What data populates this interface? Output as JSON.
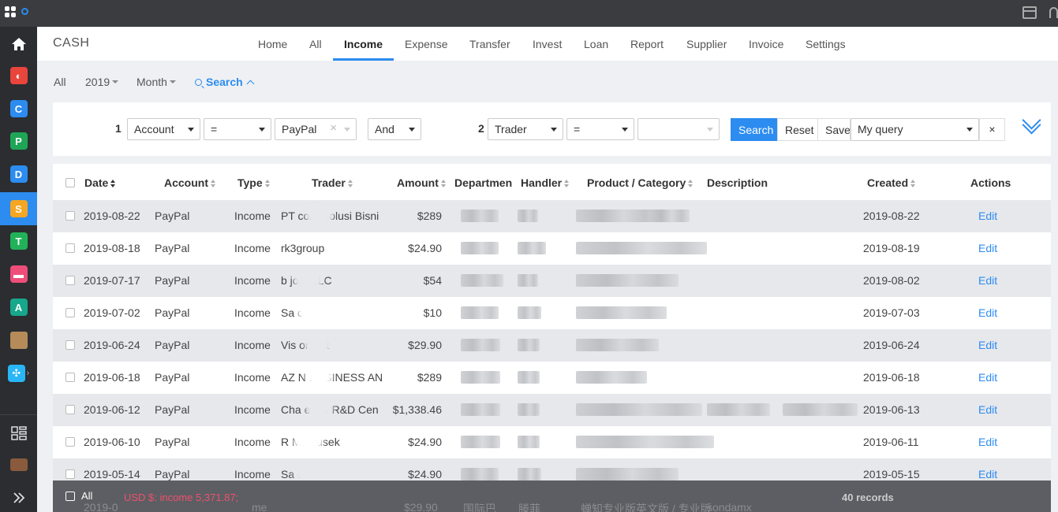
{
  "sidebar": {
    "apps": [
      {
        "name": "home",
        "color": "#ffffff",
        "letter": ""
      },
      {
        "name": "app-red",
        "color": "#e8453c",
        "letter": "◐"
      },
      {
        "name": "app-blue",
        "color": "#2c8cf0",
        "letter": "C"
      },
      {
        "name": "app-green",
        "color": "#1ea656",
        "letter": "P"
      },
      {
        "name": "app-blue2",
        "color": "#2c8cf0",
        "letter": "D"
      },
      {
        "name": "app-cash",
        "color": "#f5a623",
        "letter": "S"
      },
      {
        "name": "app-green2",
        "color": "#21b259",
        "letter": "T"
      },
      {
        "name": "app-pink",
        "color": "#ee4d7a",
        "letter": "▬"
      },
      {
        "name": "app-teal",
        "color": "#17a78b",
        "letter": "A"
      },
      {
        "name": "app-avatar",
        "color": "#b58b5a",
        "letter": ""
      },
      {
        "name": "app-more",
        "color": "#29b6f6",
        "letter": "✣"
      }
    ]
  },
  "header": {
    "brand": "CASH",
    "nav": [
      "Home",
      "All",
      "Income",
      "Expense",
      "Transfer",
      "Invest",
      "Loan",
      "Report",
      "Supplier",
      "Invoice",
      "Settings"
    ],
    "active": "Income"
  },
  "filters": {
    "all": "All",
    "year": "2019",
    "period": "Month",
    "search": "Search"
  },
  "query": {
    "c1_num": "1",
    "c1_field": "Account",
    "c1_op": "=",
    "c1_value": "PayPal",
    "logic": "And",
    "c2_num": "2",
    "c2_field": "Trader",
    "c2_op": "=",
    "c2_value": "",
    "search_btn": "Search",
    "reset_btn": "Reset",
    "save_btn": "Save",
    "saved_query": "My query",
    "clear": "×"
  },
  "table": {
    "headers": {
      "date": "Date",
      "account": "Account",
      "type": "Type",
      "trader": "Trader",
      "amount": "Amount",
      "department": "Departmen",
      "handler": "Handler",
      "product": "Product / Category",
      "description": "Description",
      "created": "Created",
      "actions": "Actions"
    },
    "rows": [
      {
        "date": "2019-08-22",
        "account": "PayPal",
        "type": "Income",
        "trader": "PT    com Solusi Bisni",
        "amount": "$289",
        "created": "2019-08-22",
        "action": "Edit"
      },
      {
        "date": "2019-08-18",
        "account": "PayPal",
        "type": "Income",
        "trader": "rk3group",
        "amount": "$24.90",
        "created": "2019-08-19",
        "action": "Edit"
      },
      {
        "date": "2019-07-17",
        "account": "PayPal",
        "type": "Income",
        "trader": "b       jour LLC",
        "amount": "$54",
        "created": "2019-08-02",
        "action": "Edit"
      },
      {
        "date": "2019-07-02",
        "account": "PayPal",
        "type": "Income",
        "trader": "Sa       o",
        "amount": "$10",
        "created": "2019-07-03",
        "action": "Edit"
      },
      {
        "date": "2019-06-24",
        "account": "PayPal",
        "type": "Income",
        "trader": "Vis        ontext",
        "amount": "$29.90",
        "created": "2019-06-24",
        "action": "Edit"
      },
      {
        "date": "2019-06-18",
        "account": "PayPal",
        "type": "Income",
        "trader": "AZ     N BUSINESS AN",
        "amount": "$289",
        "created": "2019-06-18",
        "action": "Edit"
      },
      {
        "date": "2019-06-12",
        "account": "PayPal",
        "type": "Income",
        "trader": "Cha       e US R&D Cen",
        "amount": "$1,338.46",
        "created": "2019-06-13",
        "action": "Edit"
      },
      {
        "date": "2019-06-10",
        "account": "PayPal",
        "type": "Income",
        "trader": "R       Matousek",
        "amount": "$24.90",
        "created": "2019-06-11",
        "action": "Edit"
      },
      {
        "date": "2019-05-14",
        "account": "PayPal",
        "type": "Income",
        "trader": "Sa       o",
        "amount": "$24.90",
        "created": "2019-05-15",
        "action": "Edit"
      }
    ]
  },
  "footer": {
    "all": "All",
    "summary": "USD $: income 5,371.87;",
    "records": "40 records",
    "ghost_date": "2019-0",
    "ghost_type": "me",
    "ghost_amount": "$29.90",
    "ghost_dept": "国际巴",
    "ghost_handler": "滕菲",
    "ghost_product": "蝉知专业版英文版 / 专业版",
    "ghost_desc": "sondamx"
  }
}
